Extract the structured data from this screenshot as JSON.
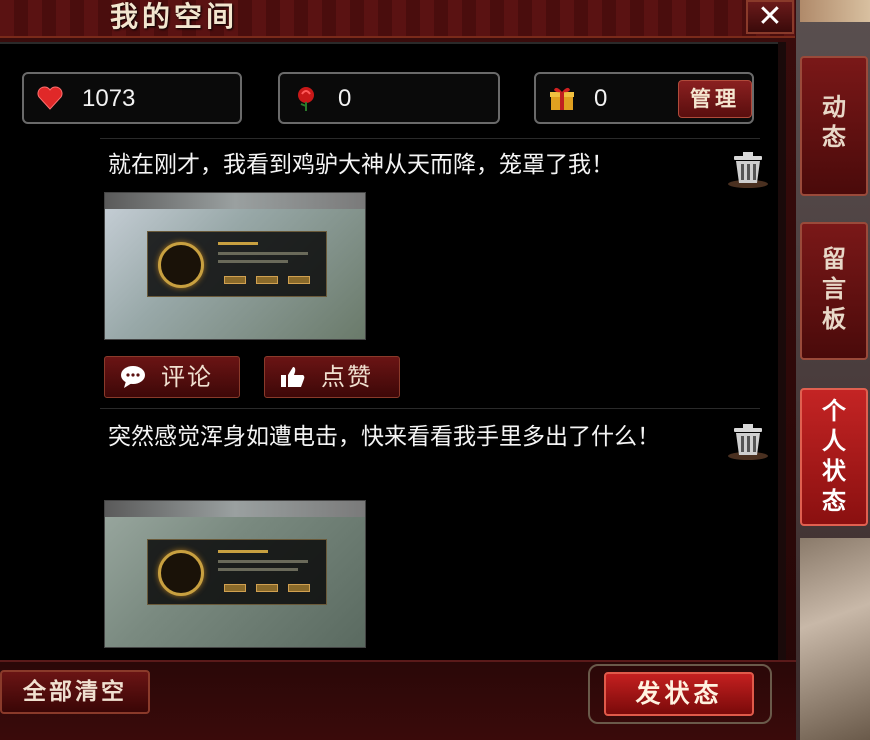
{
  "window": {
    "title": "我的空间",
    "close_label": "✕"
  },
  "stats": {
    "likes": {
      "icon": "heart-icon",
      "value": "1073"
    },
    "flowers": {
      "icon": "rose-icon",
      "value": "0"
    },
    "gifts": {
      "icon": "gift-icon",
      "value": "0",
      "manage_label": "管理"
    }
  },
  "posts": [
    {
      "text": "就在刚才，我看到鸡驴大神从天而降，笼罩了我！",
      "comment_label": "评论",
      "like_label": "点赞"
    },
    {
      "text": "突然感觉浑身如遭电击，快来看看我手里多出了什么！"
    }
  ],
  "footer": {
    "clear_all_label": "全部清空",
    "post_status_label": "发状态"
  },
  "side_tabs": [
    {
      "label": "动态",
      "active": false
    },
    {
      "label": "留言板",
      "active": false
    },
    {
      "label": "个人状态",
      "active": true
    }
  ],
  "colors": {
    "accent_red": "#c42020",
    "panel_bg": "#000000",
    "frame_red": "#3a0c0c"
  }
}
